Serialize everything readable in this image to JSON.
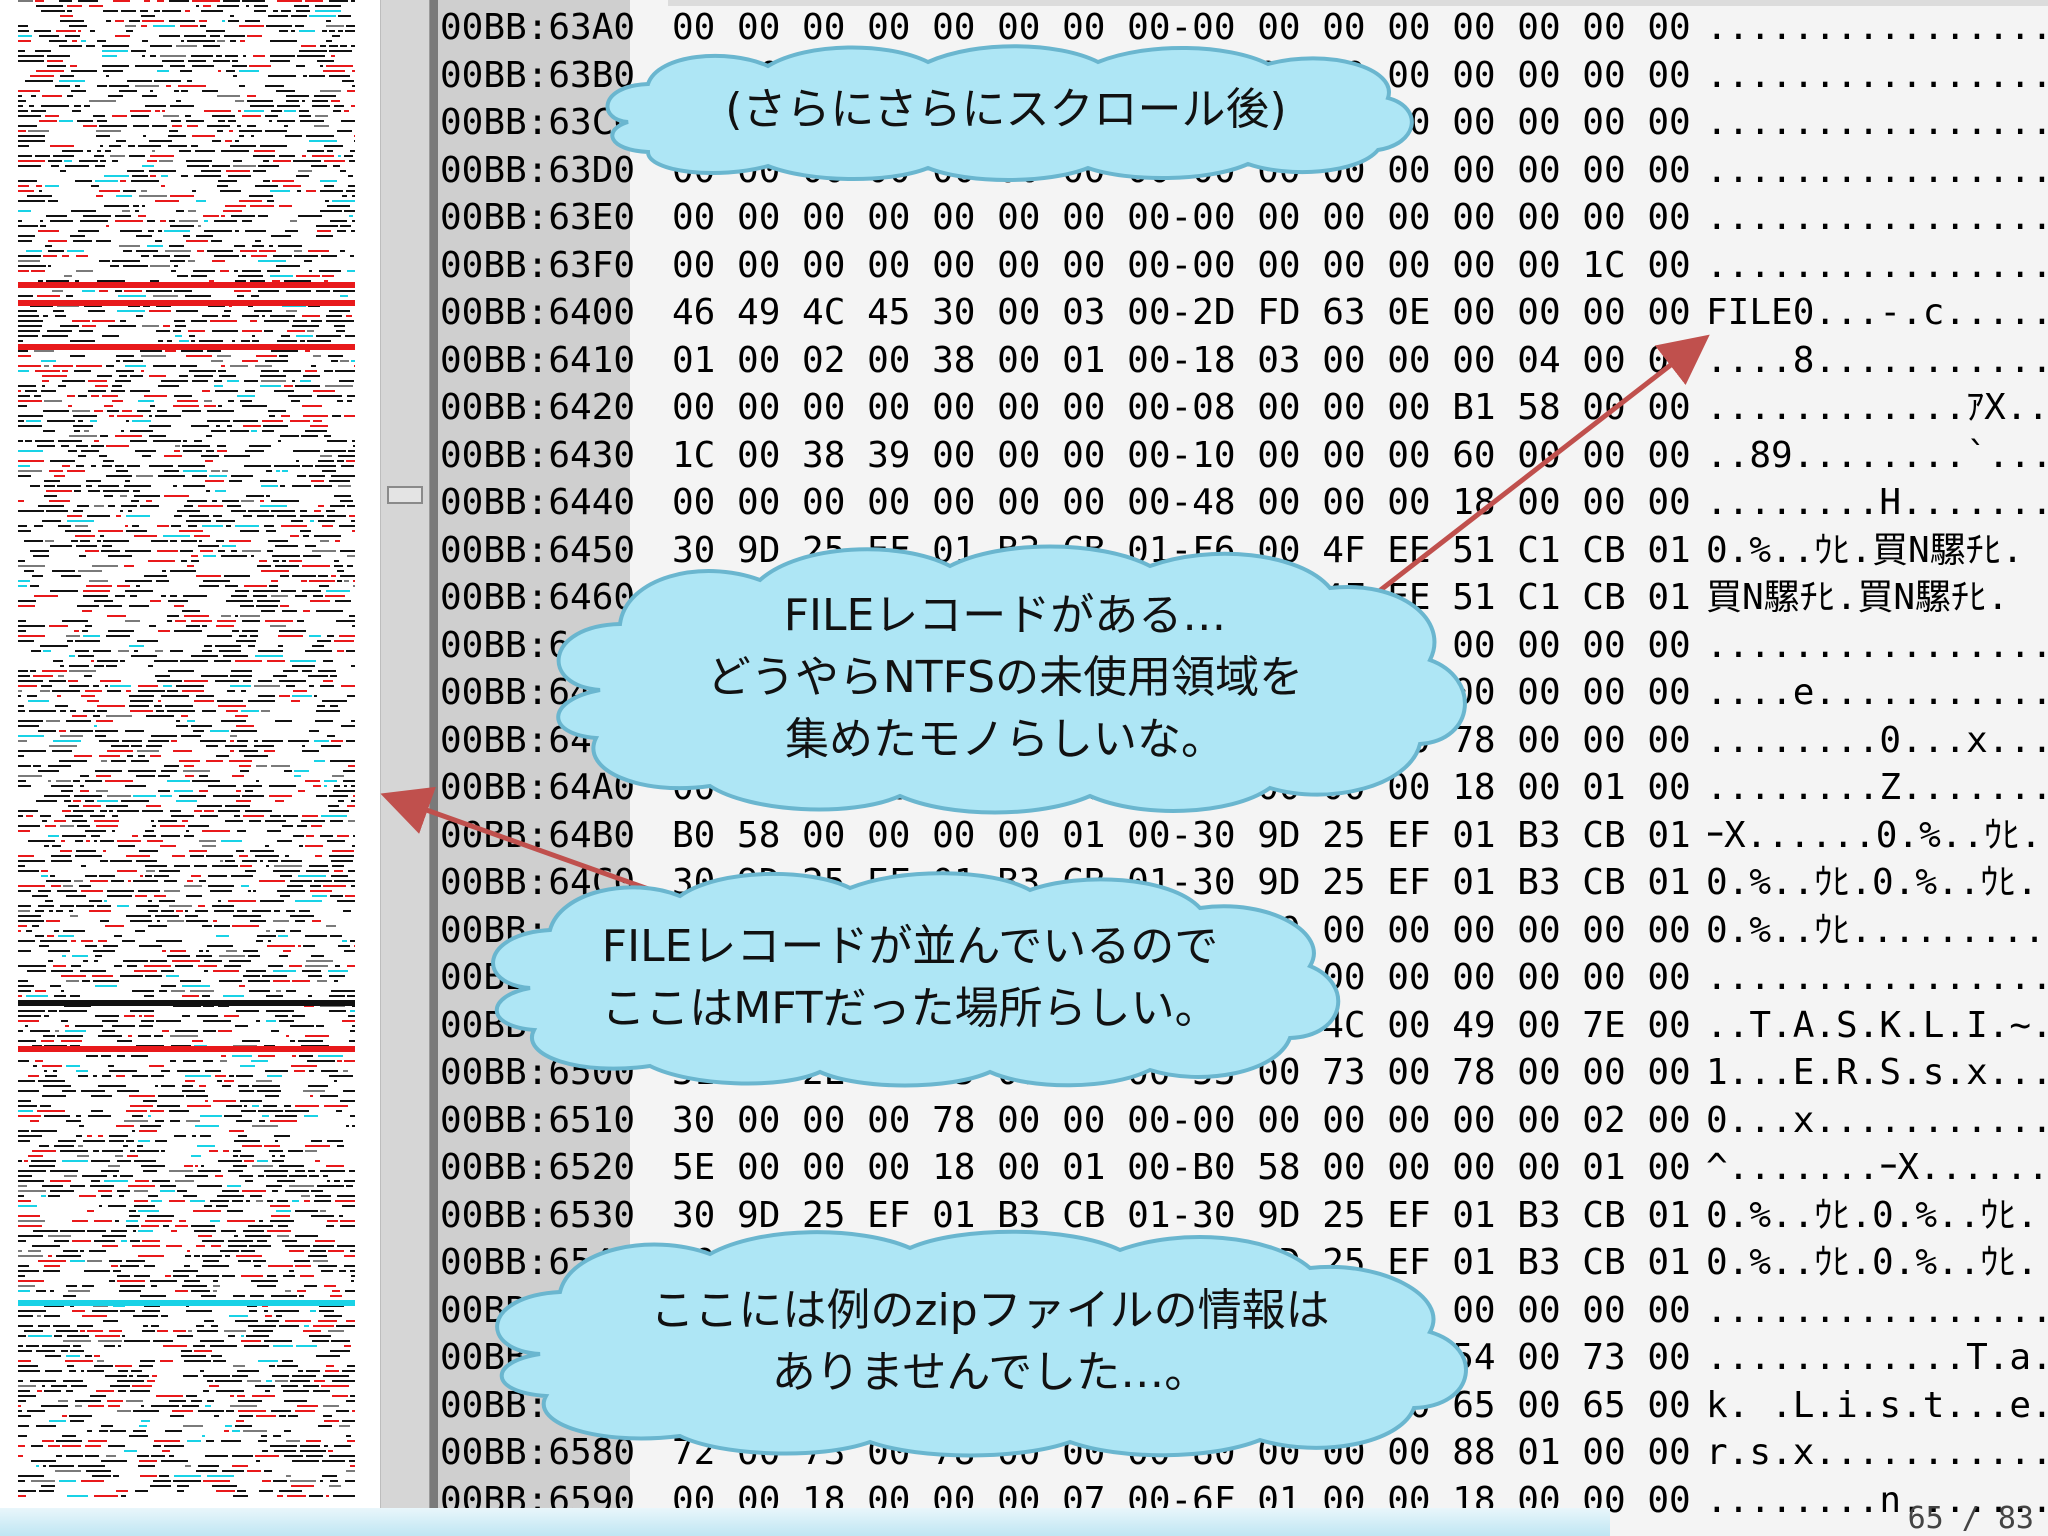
{
  "hex_view": {
    "rows": [
      {
        "addr": "00BB:63A0",
        "bytes": "00 00 00 00 00 00 00 00-00 00 00 00 00 00 00 00",
        "ascii": "................"
      },
      {
        "addr": "00BB:63B0",
        "bytes": "00 00 00 00 00 00 00 00-00 00 00 00 00 00 00 00",
        "ascii": "................"
      },
      {
        "addr": "00BB:63C0",
        "bytes": "00 00 00 00 00 00 00 00-00 00 00 00 00 00 00 00",
        "ascii": "................"
      },
      {
        "addr": "00BB:63D0",
        "bytes": "00 00 00 00 00 00 00 00-00 00 00 00 00 00 00 00",
        "ascii": "................"
      },
      {
        "addr": "00BB:63E0",
        "bytes": "00 00 00 00 00 00 00 00-00 00 00 00 00 00 00 00",
        "ascii": "................"
      },
      {
        "addr": "00BB:63F0",
        "bytes": "00 00 00 00 00 00 00 00-00 00 00 00 00 00 1C 00",
        "ascii": "................"
      },
      {
        "addr": "00BB:6400",
        "bytes": "46 49 4C 45 30 00 03 00-2D FD 63 0E 00 00 00 00",
        "ascii": "FILE0...-.c....."
      },
      {
        "addr": "00BB:6410",
        "bytes": "01 00 02 00 38 00 01 00-18 03 00 00 00 04 00 00",
        "ascii": "....8..........."
      },
      {
        "addr": "00BB:6420",
        "bytes": "00 00 00 00 00 00 00 00-08 00 00 00 B1 58 00 00",
        "ascii": "............ｱX.."
      },
      {
        "addr": "00BB:6430",
        "bytes": "1C 00 38 39 00 00 00 00-10 00 00 00 60 00 00 00",
        "ascii": "..89........`..."
      },
      {
        "addr": "00BB:6440",
        "bytes": "00 00 00 00 00 00 00 00-48 00 00 00 18 00 00 00",
        "ascii": "........H......."
      },
      {
        "addr": "00BB:6450",
        "bytes": "30 9D 25 EF 01 B3 CB 01-F6 00 4F EE 51 C1 CB 01",
        "ascii": "0.%..ｳﾋ.買N騾ﾁﾋ."
      },
      {
        "addr": "00BB:6460",
        "bytes": "F6 00 4F EE 51 C1 CB 01-F6 00 4F EE 51 C1 CB 01",
        "ascii": "買N騾ﾁﾋ.買N騾ﾁﾋ."
      },
      {
        "addr": "00BB:6470",
        "bytes": "00 00 00 00 00 00 00 00-00 00 00 00 00 00 00 00",
        "ascii": "................"
      },
      {
        "addr": "00BB:6480",
        "bytes": "00 00 00 00 65 00 00 00-00 00 00 00 00 00 00 00",
        "ascii": "....e..........."
      },
      {
        "addr": "00BB:6490",
        "bytes": "00 00 00 00 00 00 00 00-30 00 00 00 78 00 00 00",
        "ascii": "........0...x..."
      },
      {
        "addr": "00BB:64A0",
        "bytes": "00 00 00 00 00 00 00 00-5A 00 00 00 18 00 01 00",
        "ascii": "........Z......."
      },
      {
        "addr": "00BB:64B0",
        "bytes": "B0 58 00 00 00 00 01 00-30 9D 25 EF 01 B3 CB 01",
        "ascii": "ｰX......0.%..ｳﾋ."
      },
      {
        "addr": "00BB:64C0",
        "bytes": "30 9D 25 EF 01 B3 CB 01-30 9D 25 EF 01 B3 CB 01",
        "ascii": "0.%..ｳﾋ.0.%..ｳﾋ."
      },
      {
        "addr": "00BB:64D0",
        "bytes": "30 9D 25 EF 01 B3 CB 01-00 00 00 00 00 00 00 00",
        "ascii": "0.%..ｳﾋ........."
      },
      {
        "addr": "00BB:64E0",
        "bytes": "00 00 00 00 00 00 00 00-00 00 00 00 00 00 00 00",
        "ascii": "................"
      },
      {
        "addr": "00BB:64F0",
        "bytes": "00 00 54 00 41 00 53 00-4B 00 4C 00 49 00 7E 00",
        "ascii": "..T.A.S.K.L.I.~."
      },
      {
        "addr": "00BB:6500",
        "bytes": "31 00 2E 00 45 00 52 00-53 00 73 00 78 00 00 00",
        "ascii": "1...E.R.S.s.x..."
      },
      {
        "addr": "00BB:6510",
        "bytes": "30 00 00 00 78 00 00 00-00 00 00 00 00 00 02 00",
        "ascii": "0...x..........."
      },
      {
        "addr": "00BB:6520",
        "bytes": "5E 00 00 00 18 00 01 00-B0 58 00 00 00 00 01 00",
        "ascii": "^.......ｰX......"
      },
      {
        "addr": "00BB:6530",
        "bytes": "30 9D 25 EF 01 B3 CB 01-30 9D 25 EF 01 B3 CB 01",
        "ascii": "0.%..ｳﾋ.0.%..ｳﾋ."
      },
      {
        "addr": "00BB:6540",
        "bytes": "30 9D 25 EF 01 B3 CB 01-30 9D 25 EF 01 B3 CB 01",
        "ascii": "0.%..ｳﾋ.0.%..ｳﾋ."
      },
      {
        "addr": "00BB:6550",
        "bytes": "00 00 00 00 00 00 00 00-00 00 00 00 00 00 00 00",
        "ascii": "................"
      },
      {
        "addr": "00BB:6560",
        "bytes": "00 00 00 00 00 00 00 00-00 00 00 00 54 00 73 00",
        "ascii": "............T.a.s."
      },
      {
        "addr": "00BB:6570",
        "bytes": "6B 00 4C 00 69 00 73 00-74 00 2E 00 65 00 65 00",
        "ascii": "k. .L.i.s.t...e."
      },
      {
        "addr": "00BB:6580",
        "bytes": "72 00 73 00 78 00 00 00-80 00 00 00 88 01 00 00",
        "ascii": "r.s.x..........."
      },
      {
        "addr": "00BB:6590",
        "bytes": "00 00 18 00 00 00 07 00-6F 01 00 00 18 00 00 00",
        "ascii": "........n......."
      }
    ]
  },
  "callouts": {
    "scroll_note": "(さらにさらにスクロール後)",
    "file_record": "FILEレコードがある…\nどうやらNTFSの未使用領域を\n集めたモノらしいな。",
    "mft": "FILEレコードが並んでいるので\nここはMFTだった場所らしい。",
    "no_zip": "ここには例のzipファイルの情報は\nありませんでした…。"
  },
  "footer": {
    "page_indicator": "65 / 83"
  },
  "colors": {
    "cloud_fill": "#aee6f5",
    "cloud_stroke": "#6ab6cf",
    "arrow": "#c0504d",
    "minimap_red": "#e8191b",
    "minimap_cyan": "#19d2e6"
  }
}
